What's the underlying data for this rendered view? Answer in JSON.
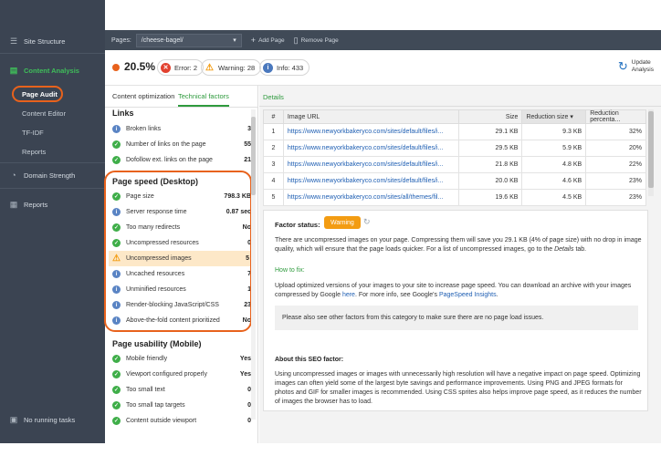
{
  "sidebar": {
    "site_structure": "Site Structure",
    "content_analysis": "Content Analysis",
    "sub_items": [
      "Page Audit",
      "Content Editor",
      "TF-IDF",
      "Reports"
    ],
    "domain_strength": "Domain Strength",
    "reports": "Reports",
    "no_tasks": "No running tasks"
  },
  "topbar": {
    "pages_label": "Pages:",
    "pages_value": "/cheese-bagel/",
    "add_page": "Add Page",
    "remove_page": "Remove Page"
  },
  "status": {
    "score": "20.5%",
    "error": "Error: 2",
    "warning": "Warning: 28",
    "info": "Info: 433",
    "update_line1": "Update",
    "update_line2": "Analysis"
  },
  "tabs": {
    "content_optimization": "Content optimization",
    "technical_factors": "Technical factors"
  },
  "sections": {
    "links": "Links",
    "page_speed": "Page speed (Desktop)",
    "page_usability": "Page usability (Mobile)"
  },
  "links_rows": [
    {
      "status": "info",
      "label": "Broken links",
      "value": "3"
    },
    {
      "status": "ok",
      "label": "Number of links on the page",
      "value": "55"
    },
    {
      "status": "ok",
      "label": "Dofollow ext. links on the page",
      "value": "21"
    }
  ],
  "speed_rows": [
    {
      "status": "ok",
      "label": "Page size",
      "value": "798.3 KB"
    },
    {
      "status": "info",
      "label": "Server response time",
      "value": "0.87 sec"
    },
    {
      "status": "ok",
      "label": "Too many redirects",
      "value": "No"
    },
    {
      "status": "ok",
      "label": "Uncompressed resources",
      "value": "0"
    },
    {
      "status": "warn",
      "label": "Uncompressed images",
      "value": "5"
    },
    {
      "status": "info",
      "label": "Uncached resources",
      "value": "7"
    },
    {
      "status": "info",
      "label": "Unminified resources",
      "value": "1"
    },
    {
      "status": "info",
      "label": "Render-blocking JavaScript/CSS",
      "value": "23"
    },
    {
      "status": "info",
      "label": "Above-the-fold content prioritized",
      "value": "No"
    }
  ],
  "usability_rows": [
    {
      "status": "ok",
      "label": "Mobile friendly",
      "value": "Yes"
    },
    {
      "status": "ok",
      "label": "Viewport configured properly",
      "value": "Yes"
    },
    {
      "status": "ok",
      "label": "Too small text",
      "value": "0"
    },
    {
      "status": "ok",
      "label": "Too small tap targets",
      "value": "0"
    },
    {
      "status": "ok",
      "label": "Content outside viewport",
      "value": "0"
    }
  ],
  "details": {
    "tab": "Details",
    "columns": [
      "#",
      "Image URL",
      "Size",
      "Reduction size",
      "Reduction percenta..."
    ],
    "rows": [
      [
        "1",
        "https://www.newyorkbakeryco.com/sites/default/files/i...",
        "29.1 KB",
        "9.3 KB",
        "32%"
      ],
      [
        "2",
        "https://www.newyorkbakeryco.com/sites/default/files/i...",
        "29.5 KB",
        "5.9 KB",
        "20%"
      ],
      [
        "3",
        "https://www.newyorkbakeryco.com/sites/default/files/i...",
        "21.8 KB",
        "4.8 KB",
        "22%"
      ],
      [
        "4",
        "https://www.newyorkbakeryco.com/sites/default/files/i...",
        "20.0 KB",
        "4.6 KB",
        "23%"
      ],
      [
        "5",
        "https://www.newyorkbakeryco.com/sites/all/themes/fil...",
        "19.6 KB",
        "4.5 KB",
        "23%"
      ]
    ]
  },
  "factor": {
    "status_label": "Factor status:",
    "status_badge": "Warning",
    "description_a": "There are uncompressed images on your page. Compressing them will save you 29.1 KB (4% of page size) with no drop in image quality, which will ensure that the page loads quicker. For a list of uncompressed images, go to the ",
    "description_link": "Details",
    "description_b": " tab.",
    "how_to_fix": "How to fix:",
    "fix_a": "Upload optimized versions of your images to your site to increase page speed. You can download an archive with your images compressed by Google ",
    "fix_here": "here",
    "fix_b": ". For more info, see Google's ",
    "fix_link": "PageSpeed Insights",
    "fix_c": ".",
    "see_also": "Please also see other factors from this category to make sure there are no page load issues.",
    "about_h": "About this SEO factor:",
    "about": "Using uncompressed images or images with unnecessarily high resolution will have a negative impact on page speed. Optimizing images can often yield some of the largest byte savings and performance improvements. Using PNG and JPEG formats for photos and GIF for smaller images is recommended. Using CSS sprites also helps improve page speed, as it reduces the number of images the browser has to load."
  },
  "colors": {
    "accent_green": "#2e9a3d",
    "highlight_orange": "#e8621c",
    "warning": "#f39c12",
    "sidebar_bg": "#3b4452"
  }
}
